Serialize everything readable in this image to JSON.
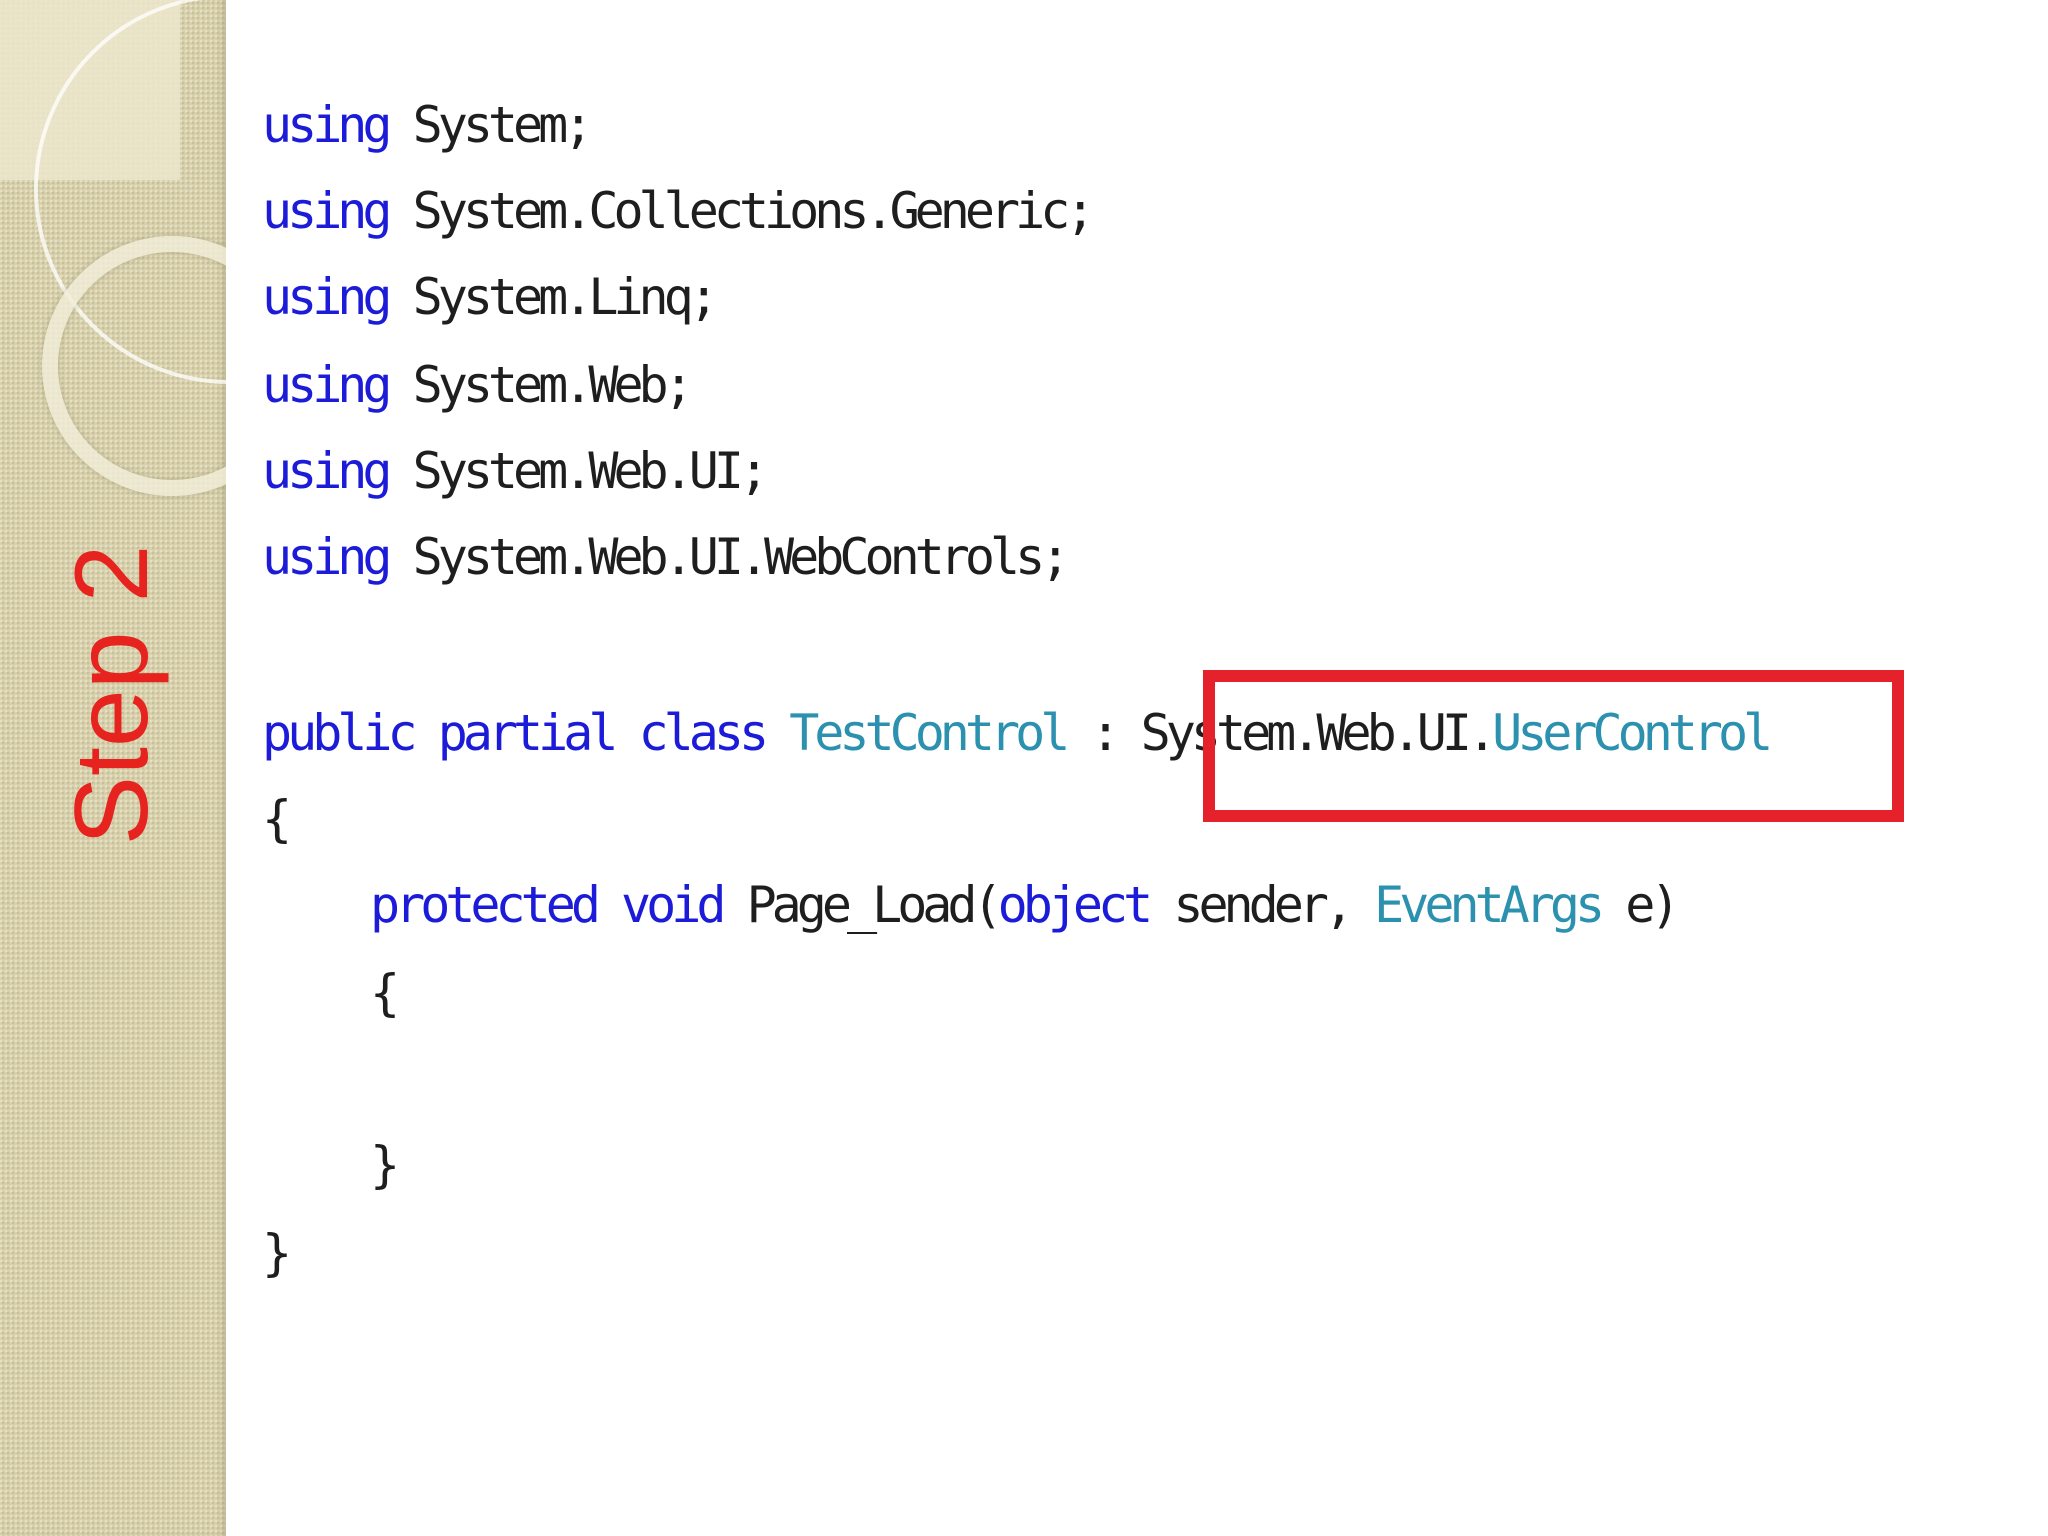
{
  "sidebar": {
    "step_label": "Step 2"
  },
  "code": {
    "keyword_color": "#1c1cd8",
    "type_color": "#2b91af",
    "using_lines": [
      {
        "keyword": "using",
        "namespace": "System;"
      },
      {
        "keyword": "using",
        "namespace": "System.Collections.Generic;"
      },
      {
        "keyword": "using",
        "namespace": "System.Linq;"
      },
      {
        "keyword": "using",
        "namespace": "System.Web;"
      },
      {
        "keyword": "using",
        "namespace": "System.Web.UI;"
      },
      {
        "keyword": "using",
        "namespace": "System.Web.UI.WebControls;"
      }
    ],
    "class_declaration": {
      "kw_public": "public",
      "kw_partial": "partial",
      "kw_class": "class",
      "class_name": "TestControl",
      "colon": ":",
      "base_namespace": "System.Web.UI.",
      "base_type": "UserControl"
    },
    "open_brace": "{",
    "method": {
      "kw_protected": "protected",
      "kw_void": "void",
      "name": "Page_Load(",
      "kw_object": "object",
      "param1": "sender,",
      "param2_type": "EventArgs",
      "param2_rest": "e)"
    },
    "method_open_brace": "{",
    "method_close_brace": "}",
    "close_brace": "}"
  },
  "highlight": {
    "color": "#e5212b",
    "target": "System.Web.UI.UserControl"
  }
}
